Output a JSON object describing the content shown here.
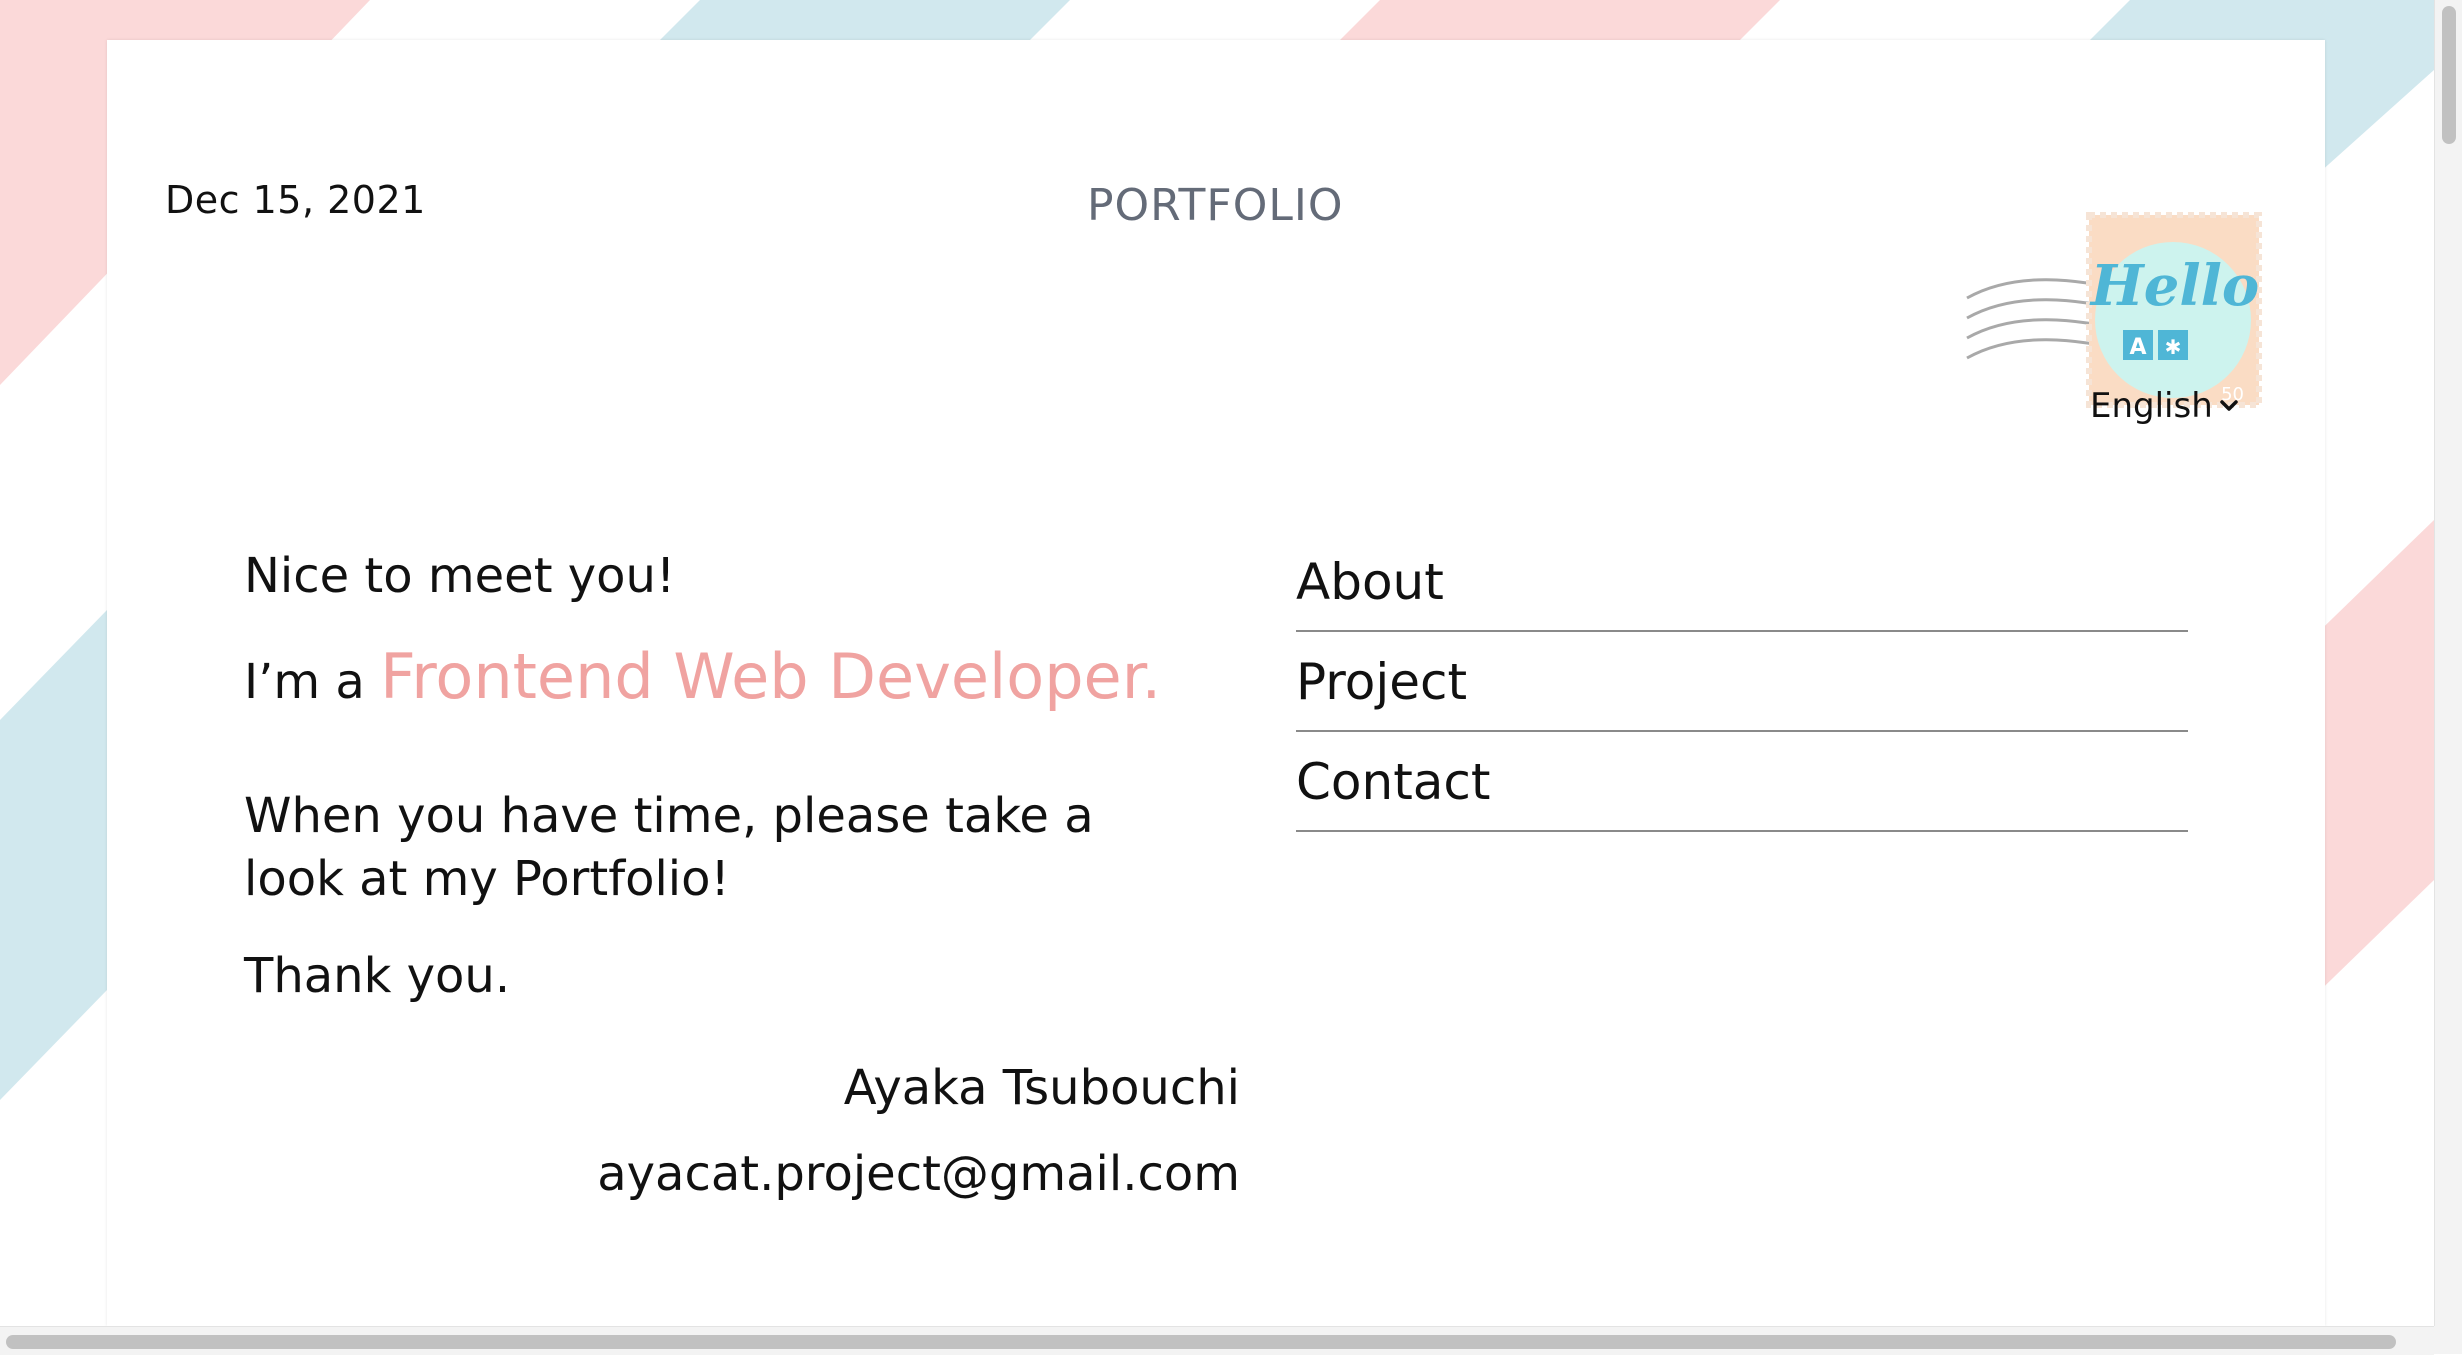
{
  "header": {
    "date": "Dec 15, 2021",
    "title": "PORTFOLIO"
  },
  "stamp": {
    "word": "Hello",
    "value": "50",
    "glyph_left": "A",
    "glyph_right": "文"
  },
  "language": {
    "selected": "English",
    "icon": "chevron-down-icon"
  },
  "message": {
    "greeting": "Nice to meet you!",
    "role_prefix": "I’m a",
    "role": "Frontend Web Developer.",
    "body": "When you have time, please take a look at my Portfolio!",
    "thanks": "Thank you."
  },
  "signature": {
    "name": "Ayaka Tsubouchi",
    "email": "ayacat.project@gmail.com"
  },
  "nav": {
    "items": [
      {
        "label": "About"
      },
      {
        "label": "Project"
      },
      {
        "label": "Contact"
      }
    ]
  },
  "colors": {
    "accent_pink": "#f0a3a1",
    "stripe_pink": "#fbd9d9",
    "stripe_blue": "#d1e8ee",
    "title_gray": "#646b78",
    "stamp_bg": "#fadcc4",
    "stamp_circle": "#cdf3ee",
    "stamp_ink": "#4fb6d6"
  }
}
